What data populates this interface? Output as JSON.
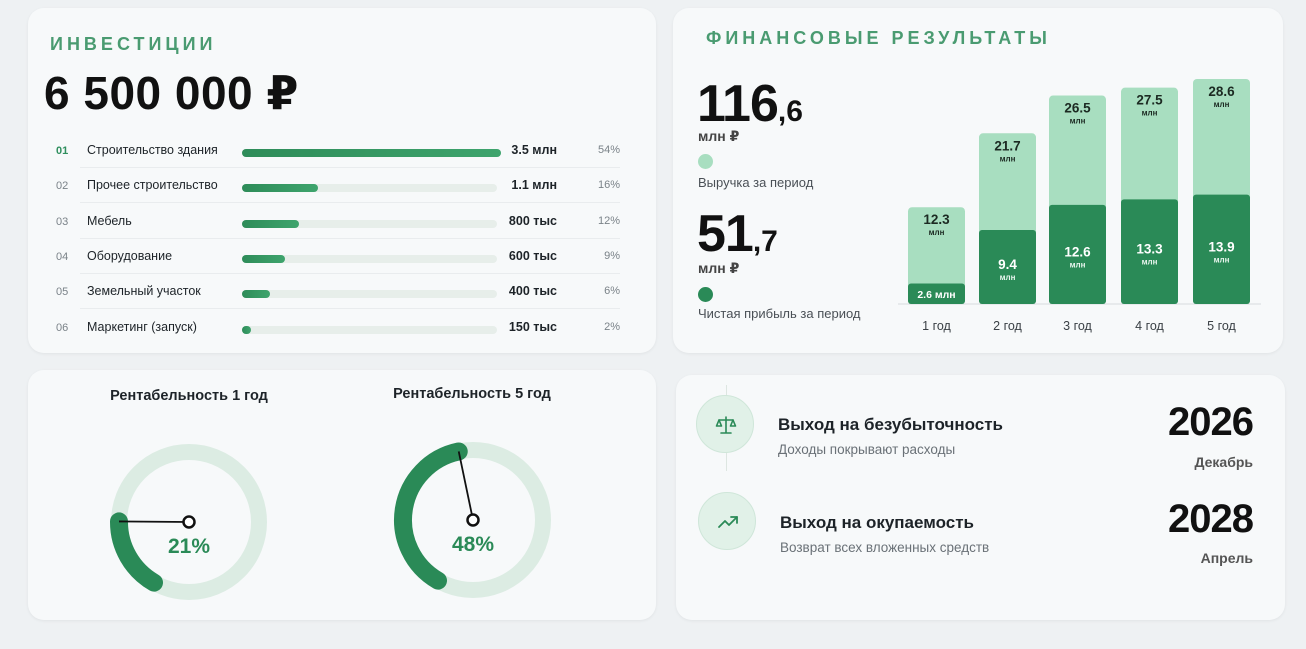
{
  "investments": {
    "title": "ИНВЕСТИЦИИ",
    "total": "6 500 000 ₽",
    "items": [
      {
        "num": "01",
        "label": "Строительство здания",
        "value": "3.5 млн",
        "pct": "54%",
        "share": 54
      },
      {
        "num": "02",
        "label": "Прочее строительство",
        "value": "1.1 млн",
        "pct": "16%",
        "share": 16
      },
      {
        "num": "03",
        "label": "Мебель",
        "value": "800 тыс",
        "pct": "12%",
        "share": 12
      },
      {
        "num": "04",
        "label": "Оборудование",
        "value": "600 тыс",
        "pct": "9%",
        "share": 9
      },
      {
        "num": "05",
        "label": "Земельный участок",
        "value": "400 тыс",
        "pct": "6%",
        "share": 6
      },
      {
        "num": "06",
        "label": "Маркетинг (запуск)",
        "value": "150 тыс",
        "pct": "2%",
        "share": 2
      }
    ]
  },
  "finance": {
    "title": "ФИНАНСОВЫЕ РЕЗУЛЬТАТЫ",
    "revenue": {
      "int": "116",
      "dec": ",6",
      "unit": "млн ₽",
      "label": "Выручка за период"
    },
    "profit": {
      "int": "51",
      "dec": ",7",
      "unit": "млн ₽",
      "label": "Чистая прибыль за период"
    }
  },
  "chart_data": {
    "type": "bar",
    "stacked": "overlay",
    "categories": [
      "1 год",
      "2 год",
      "3 год",
      "4 год",
      "5 год"
    ],
    "series": [
      {
        "name": "Выручка за период",
        "values": [
          12.3,
          21.7,
          26.5,
          27.5,
          28.6
        ],
        "color": "#a8dec0"
      },
      {
        "name": "Чистая прибыль за период",
        "values": [
          2.6,
          9.4,
          12.6,
          13.3,
          13.9
        ],
        "color": "#2a8a57"
      }
    ],
    "value_unit": "млн",
    "ylim": [
      0,
      30
    ],
    "grid": false
  },
  "profitability": {
    "gauges": [
      {
        "title": "Рентабельность 1 год",
        "value_label": "21%",
        "value": 21
      },
      {
        "title": "Рентабельность 5 год",
        "value_label": "48%",
        "value": 48
      }
    ]
  },
  "milestones": [
    {
      "title": "Выход на безубыточность",
      "subtitle": "Доходы покрывают расходы",
      "year": "2026",
      "month": "Декабрь",
      "icon": "scales-icon"
    },
    {
      "title": "Выход на окупаемость",
      "subtitle": "Возврат всех вложенных средств",
      "year": "2028",
      "month": "Апрель",
      "icon": "trend-up-icon"
    }
  ],
  "colors": {
    "accent": "#2a8a57",
    "accent_light": "#a8dec0",
    "title_green": "#4a9b71",
    "gauge_track": "#dcece3"
  }
}
